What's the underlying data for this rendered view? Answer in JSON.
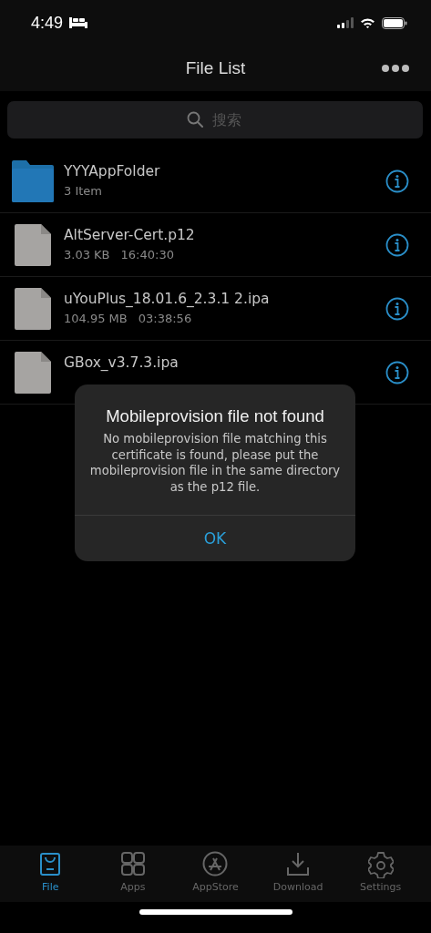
{
  "status_bar": {
    "time": "4:49"
  },
  "nav": {
    "title": "File List"
  },
  "search": {
    "placeholder": "搜索"
  },
  "files": [
    {
      "kind": "folder",
      "name": "YYYAppFolder",
      "size": "3 Item"
    },
    {
      "kind": "file",
      "name": "AltServer-Cert.p12",
      "size": "3.03 KB",
      "time": "16:40:30"
    },
    {
      "kind": "file",
      "name": "uYouPlus_18.01.6_2.3.1 2.ipa",
      "size": "104.95 MB",
      "time": "03:38:56"
    },
    {
      "kind": "file",
      "name": "GBox_v3.7.3.ipa"
    }
  ],
  "alert": {
    "title": "Mobileprovision file not found",
    "message": "No mobileprovision file matching this certificate is found, please put the mobileprovision file in the same directory as the p12 file.",
    "button": "OK"
  },
  "tabs": [
    {
      "kind": "file",
      "label": "File",
      "selected": true
    },
    {
      "kind": "apps",
      "label": "Apps",
      "selected": false
    },
    {
      "kind": "appstore",
      "label": "AppStore",
      "selected": false
    },
    {
      "kind": "download",
      "label": "Download",
      "selected": false
    },
    {
      "kind": "settings",
      "label": "Settings",
      "selected": false
    }
  ]
}
